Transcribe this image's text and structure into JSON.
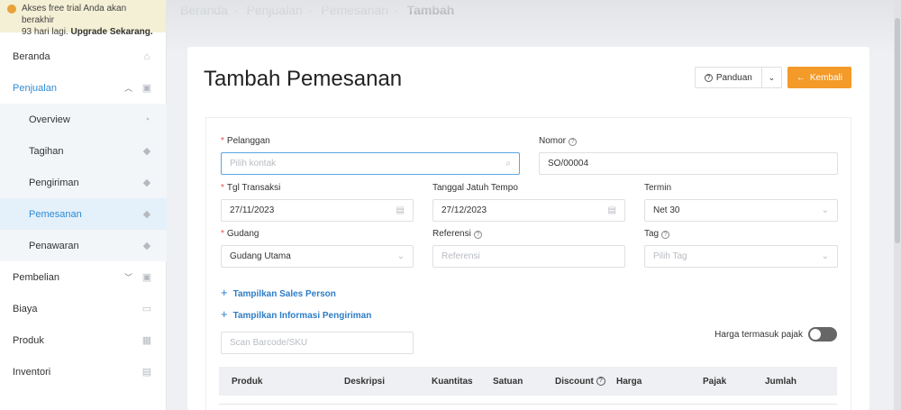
{
  "trial": {
    "line1": "Akses free trial Anda akan berakhir",
    "line2_prefix": "93 hari lagi. ",
    "line2_link": "Upgrade Sekarang."
  },
  "breadcrumb": {
    "items": [
      "Beranda",
      "Penjualan",
      "Pemesanan"
    ],
    "current": "Tambah"
  },
  "sidebar": {
    "items": [
      {
        "label": "Beranda",
        "icon": "home-icon"
      },
      {
        "label": "Penjualan",
        "icon": "shop-icon"
      },
      {
        "label": "Pembelian",
        "icon": "bag-icon"
      },
      {
        "label": "Biaya",
        "icon": "card-icon"
      },
      {
        "label": "Produk",
        "icon": "box-icon"
      },
      {
        "label": "Inventori",
        "icon": "warehouse-icon"
      }
    ],
    "sub": [
      {
        "label": "Overview",
        "icon": "pie-icon"
      },
      {
        "label": "Tagihan",
        "icon": "tag-icon"
      },
      {
        "label": "Pengiriman",
        "icon": "tag-icon"
      },
      {
        "label": "Pemesanan",
        "icon": "tag-icon",
        "active": true
      },
      {
        "label": "Penawaran",
        "icon": "tag-icon"
      }
    ]
  },
  "page": {
    "title": "Tambah Pemesanan"
  },
  "buttons": {
    "guide": "Panduan",
    "back": "Kembali"
  },
  "form": {
    "customer": {
      "label": "Pelanggan",
      "placeholder": "Pilih kontak"
    },
    "number": {
      "label": "Nomor",
      "value": "SO/00004"
    },
    "trans_date": {
      "label": "Tgl Transaksi",
      "value": "27/11/2023"
    },
    "due_date": {
      "label": "Tanggal Jatuh Tempo",
      "value": "27/12/2023"
    },
    "term": {
      "label": "Termin",
      "value": "Net 30"
    },
    "warehouse": {
      "label": "Gudang",
      "value": "Gudang Utama"
    },
    "reference": {
      "label": "Referensi",
      "placeholder": "Referensi"
    },
    "tag": {
      "label": "Tag",
      "placeholder": "Pilih Tag"
    },
    "show_sales": "Tampilkan Sales Person",
    "show_shipping": "Tampilkan Informasi Pengiriman",
    "barcode": {
      "placeholder": "Scan Barcode/SKU"
    },
    "tax_toggle": {
      "label": "Harga termasuk pajak",
      "on": false
    }
  },
  "table": {
    "headers": [
      "Produk",
      "Deskripsi",
      "Kuantitas",
      "Satuan",
      "Discount",
      "Harga",
      "Pajak",
      "Jumlah"
    ]
  },
  "colors": {
    "accent": "#2e8bd6",
    "back_button": "#f39a29",
    "trial_bg": "#f4f0d6"
  }
}
